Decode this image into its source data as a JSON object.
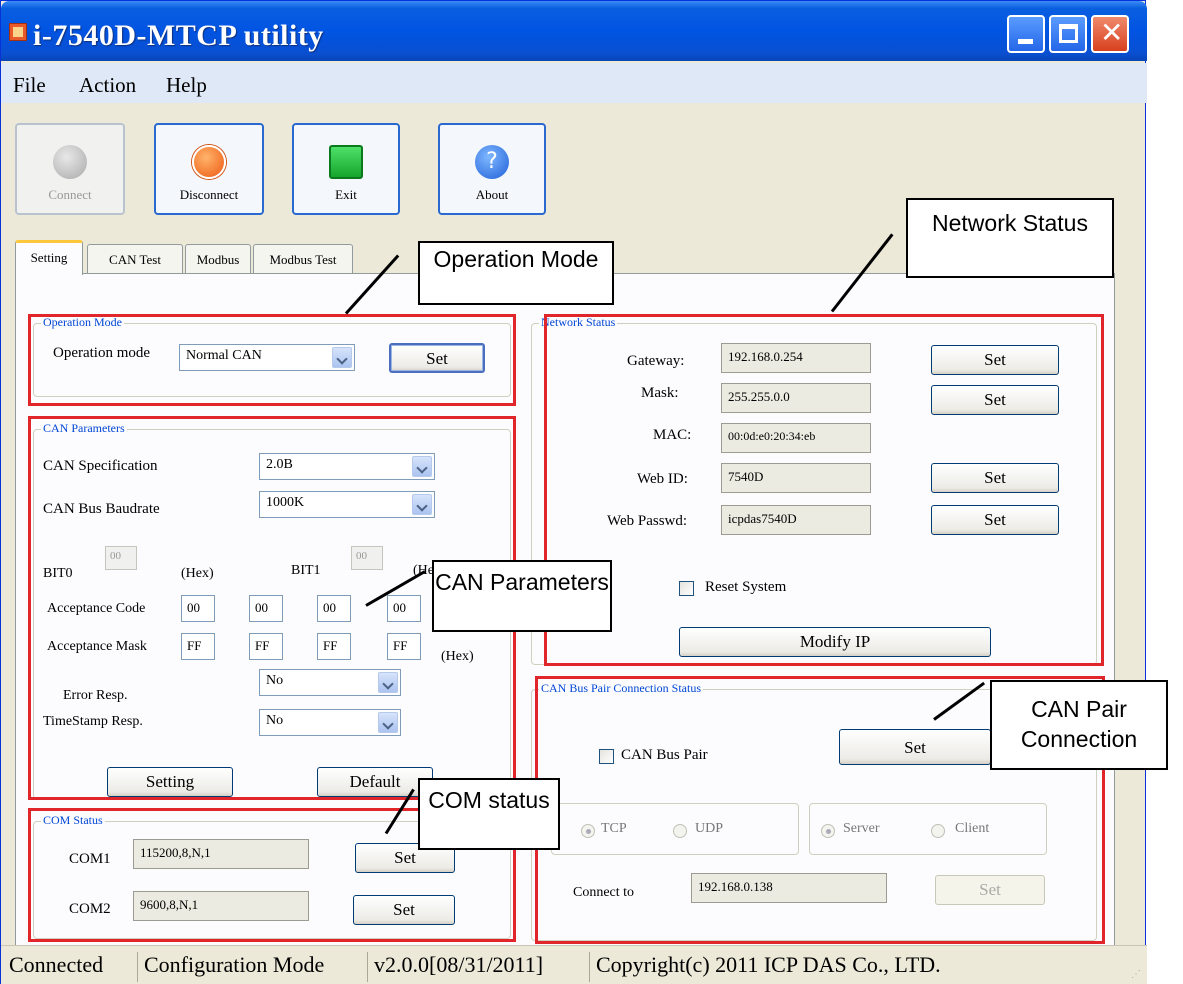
{
  "window": {
    "title": "i-7540D-MTCP utility"
  },
  "menu": [
    "File",
    "Action",
    "Help"
  ],
  "toolbar": {
    "connect": "Connect",
    "disconnect": "Disconnect",
    "exit": "Exit",
    "about": "About"
  },
  "tabs": [
    "Setting",
    "CAN Test",
    "Modbus",
    "Modbus Test"
  ],
  "operation_mode": {
    "group_title": "Operation Mode",
    "label": "Operation mode",
    "value": "Normal CAN",
    "set_label": "Set"
  },
  "can_params": {
    "group_title": "CAN Parameters",
    "spec_label": "CAN Specification",
    "spec_value": "2.0B",
    "baud_label": "CAN Bus Baudrate",
    "baud_value": "1000K",
    "bit0_label": "BIT0",
    "bit0_value": "00",
    "bit1_label": "BIT1",
    "bit1_value": "00",
    "hex_label": "(Hex)",
    "acc_code_label": "Acceptance Code",
    "acc_code": [
      "00",
      "00",
      "00",
      "00"
    ],
    "acc_mask_label": "Acceptance Mask",
    "acc_mask": [
      "FF",
      "FF",
      "FF",
      "FF"
    ],
    "error_resp_label": "Error Resp.",
    "error_resp_value": "No",
    "timestamp_label": "TimeStamp Resp.",
    "timestamp_value": "No",
    "setting_label": "Setting",
    "default_label": "Default"
  },
  "com_status": {
    "group_title": "COM Status",
    "com1_label": "COM1",
    "com1_value": "115200,8,N,1",
    "com2_label": "COM2",
    "com2_value": "9600,8,N,1",
    "set_label": "Set"
  },
  "network": {
    "group_title": "Network Status",
    "gateway_label": "Gateway:",
    "gateway_value": "192.168.0.254",
    "mask_label": "Mask:",
    "mask_value": "255.255.0.0",
    "mac_label": "MAC:",
    "mac_value": "00:0d:e0:20:34:eb",
    "webid_label": "Web ID:",
    "webid_value": "7540D",
    "webpass_label": "Web Passwd:",
    "webpass_value": "icpdas7540D",
    "set_label": "Set",
    "reset_label": "Reset System",
    "modify_ip_label": "Modify IP"
  },
  "can_pair": {
    "group_title": "CAN Bus Pair Connection Status",
    "pair_label": "CAN Bus Pair",
    "set_label": "Set",
    "tcp_label": "TCP",
    "udp_label": "UDP",
    "server_label": "Server",
    "client_label": "Client",
    "connect_to_label": "Connect to",
    "connect_to_value": "192.168.0.138"
  },
  "callouts": {
    "operation_mode": "Operation Mode",
    "network_status": "Network Status",
    "can_parameters": "CAN Parameters",
    "can_pair": "CAN Pair Connection",
    "com_status": "COM status"
  },
  "status": {
    "state": "Connected",
    "mode": "Configuration Mode",
    "version": "v2.0.0[08/31/2011]",
    "copyright": "Copyright(c) 2011 ICP DAS Co., LTD."
  }
}
